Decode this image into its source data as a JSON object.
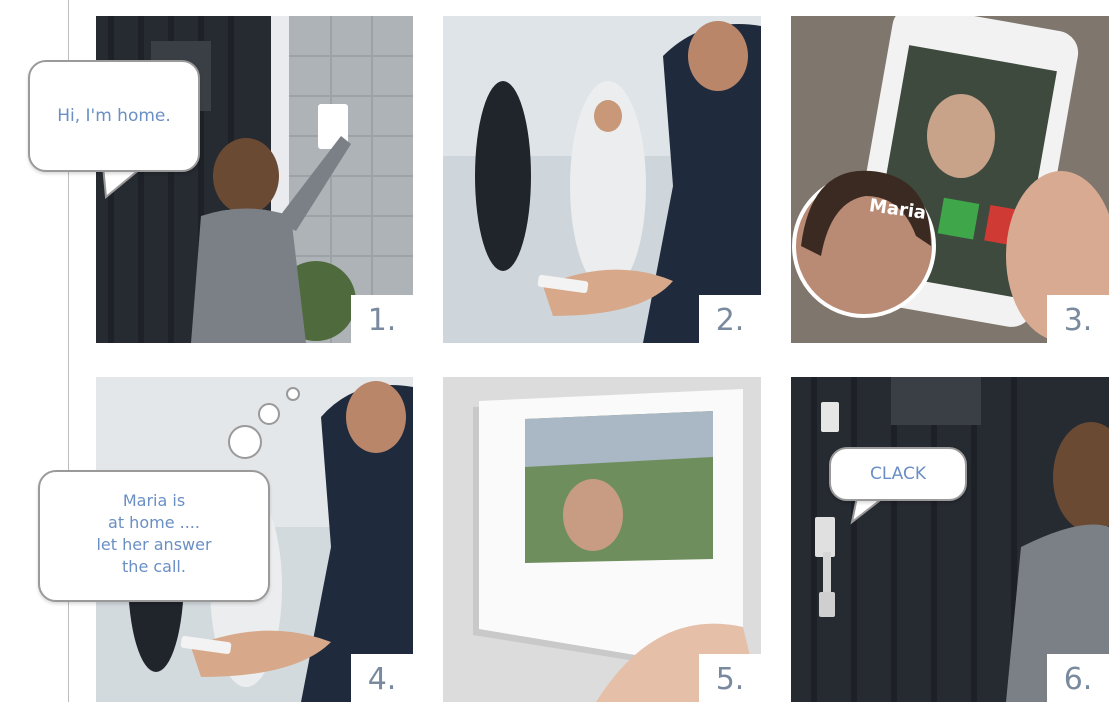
{
  "panels": [
    {
      "number": "1."
    },
    {
      "number": "2."
    },
    {
      "number": "3."
    },
    {
      "number": "4."
    },
    {
      "number": "5."
    },
    {
      "number": "6."
    }
  ],
  "bubbles": {
    "home": "Hi, I'm home.",
    "maria_thought": [
      "Maria is",
      "at home ....",
      "let her answer",
      "the call."
    ],
    "clack": "CLACK"
  },
  "phone_caller_name": "Maria",
  "colors": {
    "bubble_text": "#6a8fc4",
    "number_text": "#7a8a9e",
    "divider": "#bdbdbd"
  }
}
